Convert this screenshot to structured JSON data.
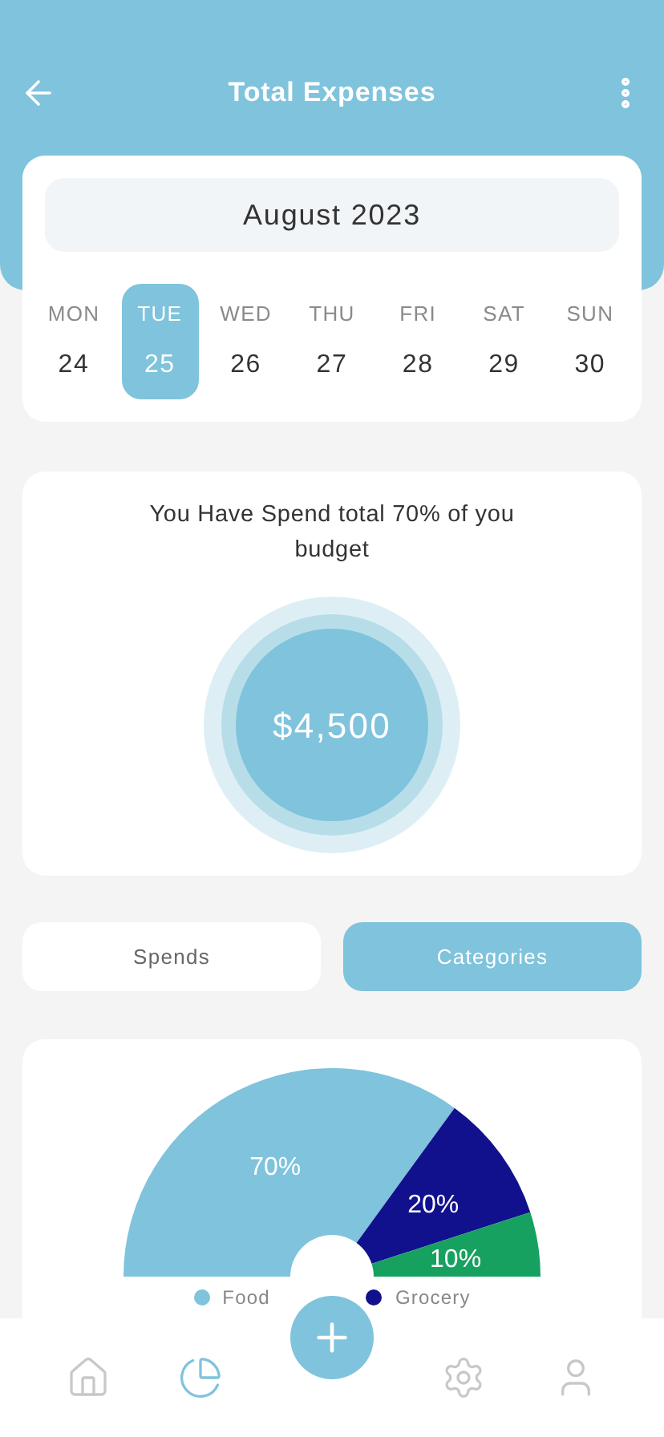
{
  "header": {
    "title": "Total Expenses"
  },
  "calendar": {
    "month": "August 2023",
    "days": [
      {
        "weekday": "MON",
        "date": "24",
        "selected": false
      },
      {
        "weekday": "TUE",
        "date": "25",
        "selected": true
      },
      {
        "weekday": "WED",
        "date": "26",
        "selected": false
      },
      {
        "weekday": "THU",
        "date": "27",
        "selected": false
      },
      {
        "weekday": "FRI",
        "date": "28",
        "selected": false
      },
      {
        "weekday": "SAT",
        "date": "29",
        "selected": false
      },
      {
        "weekday": "SUN",
        "date": "30",
        "selected": false
      }
    ]
  },
  "budget": {
    "message": "You Have Spend total 70% of you budget",
    "amount": "$4,500"
  },
  "tabs": [
    {
      "label": "Spends",
      "selected": false
    },
    {
      "label": "Categories",
      "selected": true
    }
  ],
  "breakdown": {
    "chart_data": {
      "type": "pie",
      "values": [
        70,
        20,
        10
      ],
      "colors": [
        "#7fc3dc",
        "#11118e",
        "#17a160"
      ],
      "value_labels": [
        "70%",
        "20%",
        "10%"
      ]
    },
    "legend": [
      {
        "name": "Food",
        "color": "#7fc3dc"
      },
      {
        "name": "Grocery",
        "color": "#11118e"
      }
    ]
  },
  "nav": [
    {
      "kind": "home",
      "selected": false
    },
    {
      "kind": "chart",
      "selected": true
    },
    {
      "kind": "add",
      "selected": false
    },
    {
      "kind": "settings",
      "selected": false
    },
    {
      "kind": "profile",
      "selected": false
    }
  ]
}
